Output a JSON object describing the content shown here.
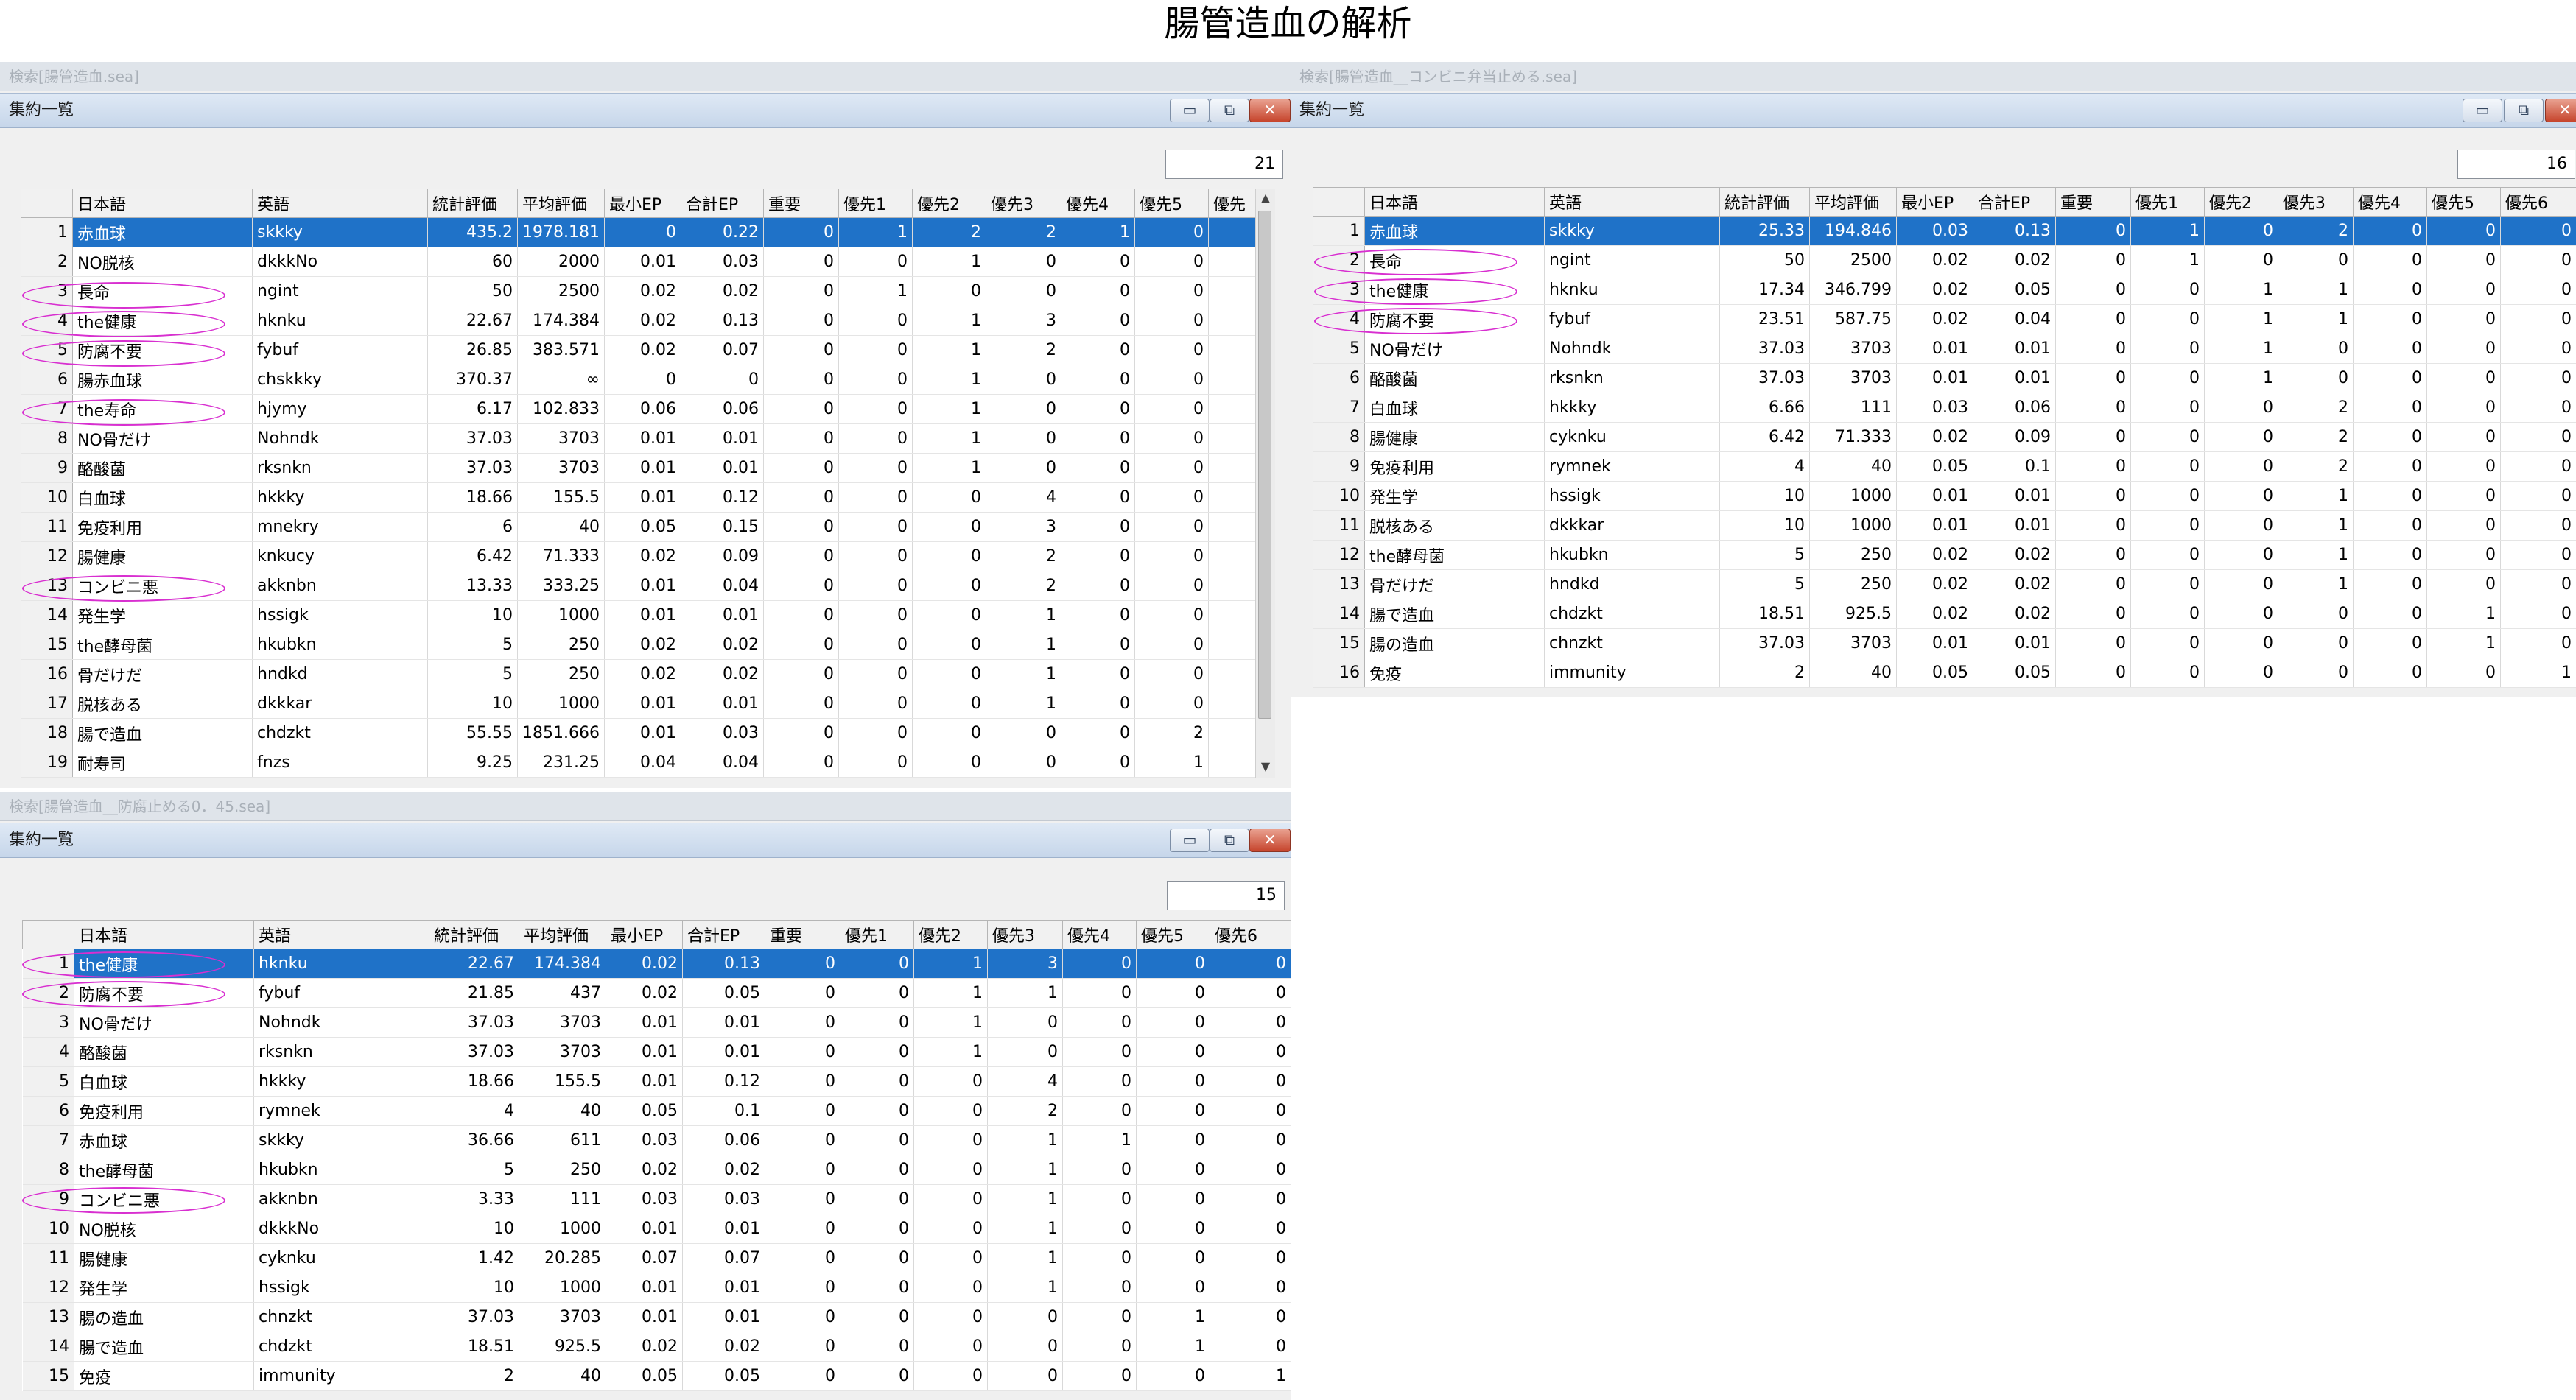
{
  "page_title": "腸管造血の解析",
  "windows": [
    {
      "id": "w1",
      "search_title": "検索[腸管造血.sea]",
      "window_title": "集約一覧",
      "count": "21",
      "columns": [
        "日本語",
        "英語",
        "統計評価",
        "平均評価",
        "最小EP",
        "合計EP",
        "重要",
        "優先1",
        "優先2",
        "優先3",
        "優先4",
        "優先5",
        "優先"
      ],
      "rows": [
        [
          "1",
          "赤血球",
          "skkky",
          "435.2",
          "1978.181",
          "0",
          "0.22",
          "0",
          "1",
          "2",
          "2",
          "1",
          "0",
          ""
        ],
        [
          "2",
          "NO脱核",
          "dkkkNo",
          "60",
          "2000",
          "0.01",
          "0.03",
          "0",
          "0",
          "1",
          "0",
          "0",
          "0",
          ""
        ],
        [
          "3",
          "長命",
          "ngint",
          "50",
          "2500",
          "0.02",
          "0.02",
          "0",
          "1",
          "0",
          "0",
          "0",
          "0",
          ""
        ],
        [
          "4",
          "the健康",
          "hknku",
          "22.67",
          "174.384",
          "0.02",
          "0.13",
          "0",
          "0",
          "1",
          "3",
          "0",
          "0",
          ""
        ],
        [
          "5",
          "防腐不要",
          "fybuf",
          "26.85",
          "383.571",
          "0.02",
          "0.07",
          "0",
          "0",
          "1",
          "2",
          "0",
          "0",
          ""
        ],
        [
          "6",
          "腸赤血球",
          "chskkky",
          "370.37",
          "∞",
          "0",
          "0",
          "0",
          "0",
          "1",
          "0",
          "0",
          "0",
          ""
        ],
        [
          "7",
          "the寿命",
          "hjymy",
          "6.17",
          "102.833",
          "0.06",
          "0.06",
          "0",
          "0",
          "1",
          "0",
          "0",
          "0",
          ""
        ],
        [
          "8",
          "NO骨だけ",
          "Nohndk",
          "37.03",
          "3703",
          "0.01",
          "0.01",
          "0",
          "0",
          "1",
          "0",
          "0",
          "0",
          ""
        ],
        [
          "9",
          "酪酸菌",
          "rksnkn",
          "37.03",
          "3703",
          "0.01",
          "0.01",
          "0",
          "0",
          "1",
          "0",
          "0",
          "0",
          ""
        ],
        [
          "10",
          "白血球",
          "hkkky",
          "18.66",
          "155.5",
          "0.01",
          "0.12",
          "0",
          "0",
          "0",
          "4",
          "0",
          "0",
          ""
        ],
        [
          "11",
          "免疫利用",
          "mnekry",
          "6",
          "40",
          "0.05",
          "0.15",
          "0",
          "0",
          "0",
          "3",
          "0",
          "0",
          ""
        ],
        [
          "12",
          "腸健康",
          "knkucy",
          "6.42",
          "71.333",
          "0.02",
          "0.09",
          "0",
          "0",
          "0",
          "2",
          "0",
          "0",
          ""
        ],
        [
          "13",
          "コンビニ悪",
          "akknbn",
          "13.33",
          "333.25",
          "0.01",
          "0.04",
          "0",
          "0",
          "0",
          "2",
          "0",
          "0",
          ""
        ],
        [
          "14",
          "発生学",
          "hssigk",
          "10",
          "1000",
          "0.01",
          "0.01",
          "0",
          "0",
          "0",
          "1",
          "0",
          "0",
          ""
        ],
        [
          "15",
          "the酵母菌",
          "hkubkn",
          "5",
          "250",
          "0.02",
          "0.02",
          "0",
          "0",
          "0",
          "1",
          "0",
          "0",
          ""
        ],
        [
          "16",
          "骨だけだ",
          "hndkd",
          "5",
          "250",
          "0.02",
          "0.02",
          "0",
          "0",
          "0",
          "1",
          "0",
          "0",
          ""
        ],
        [
          "17",
          "脱核ある",
          "dkkkar",
          "10",
          "1000",
          "0.01",
          "0.01",
          "0",
          "0",
          "0",
          "1",
          "0",
          "0",
          ""
        ],
        [
          "18",
          "腸で造血",
          "chdzkt",
          "55.55",
          "1851.666",
          "0.01",
          "0.03",
          "0",
          "0",
          "0",
          "0",
          "0",
          "2",
          ""
        ],
        [
          "19",
          "耐寿司",
          "fnzs",
          "9.25",
          "231.25",
          "0.04",
          "0.04",
          "0",
          "0",
          "0",
          "0",
          "0",
          "1",
          ""
        ]
      ]
    },
    {
      "id": "w2",
      "search_title": "検索[腸管造血__コンビニ弁当止める.sea]",
      "window_title": "集約一覧",
      "count": "16",
      "columns": [
        "日本語",
        "英語",
        "統計評価",
        "平均評価",
        "最小EP",
        "合計EP",
        "重要",
        "優先1",
        "優先2",
        "優先3",
        "優先4",
        "優先5",
        "優先6"
      ],
      "rows": [
        [
          "1",
          "赤血球",
          "skkky",
          "25.33",
          "194.846",
          "0.03",
          "0.13",
          "0",
          "1",
          "0",
          "2",
          "0",
          "0",
          "0"
        ],
        [
          "2",
          "長命",
          "ngint",
          "50",
          "2500",
          "0.02",
          "0.02",
          "0",
          "1",
          "0",
          "0",
          "0",
          "0",
          "0"
        ],
        [
          "3",
          "the健康",
          "hknku",
          "17.34",
          "346.799",
          "0.02",
          "0.05",
          "0",
          "0",
          "1",
          "1",
          "0",
          "0",
          "0"
        ],
        [
          "4",
          "防腐不要",
          "fybuf",
          "23.51",
          "587.75",
          "0.02",
          "0.04",
          "0",
          "0",
          "1",
          "1",
          "0",
          "0",
          "0"
        ],
        [
          "5",
          "NO骨だけ",
          "Nohndk",
          "37.03",
          "3703",
          "0.01",
          "0.01",
          "0",
          "0",
          "1",
          "0",
          "0",
          "0",
          "0"
        ],
        [
          "6",
          "酪酸菌",
          "rksnkn",
          "37.03",
          "3703",
          "0.01",
          "0.01",
          "0",
          "0",
          "1",
          "0",
          "0",
          "0",
          "0"
        ],
        [
          "7",
          "白血球",
          "hkkky",
          "6.66",
          "111",
          "0.03",
          "0.06",
          "0",
          "0",
          "0",
          "2",
          "0",
          "0",
          "0"
        ],
        [
          "8",
          "腸健康",
          "cyknku",
          "6.42",
          "71.333",
          "0.02",
          "0.09",
          "0",
          "0",
          "0",
          "2",
          "0",
          "0",
          "0"
        ],
        [
          "9",
          "免疫利用",
          "rymnek",
          "4",
          "40",
          "0.05",
          "0.1",
          "0",
          "0",
          "0",
          "2",
          "0",
          "0",
          "0"
        ],
        [
          "10",
          "発生学",
          "hssigk",
          "10",
          "1000",
          "0.01",
          "0.01",
          "0",
          "0",
          "0",
          "1",
          "0",
          "0",
          "0"
        ],
        [
          "11",
          "脱核ある",
          "dkkkar",
          "10",
          "1000",
          "0.01",
          "0.01",
          "0",
          "0",
          "0",
          "1",
          "0",
          "0",
          "0"
        ],
        [
          "12",
          "the酵母菌",
          "hkubkn",
          "5",
          "250",
          "0.02",
          "0.02",
          "0",
          "0",
          "0",
          "1",
          "0",
          "0",
          "0"
        ],
        [
          "13",
          "骨だけだ",
          "hndkd",
          "5",
          "250",
          "0.02",
          "0.02",
          "0",
          "0",
          "0",
          "1",
          "0",
          "0",
          "0"
        ],
        [
          "14",
          "腸で造血",
          "chdzkt",
          "18.51",
          "925.5",
          "0.02",
          "0.02",
          "0",
          "0",
          "0",
          "0",
          "0",
          "1",
          "0"
        ],
        [
          "15",
          "腸の造血",
          "chnzkt",
          "37.03",
          "3703",
          "0.01",
          "0.01",
          "0",
          "0",
          "0",
          "0",
          "0",
          "1",
          "0"
        ],
        [
          "16",
          "免疫",
          "immunity",
          "2",
          "40",
          "0.05",
          "0.05",
          "0",
          "0",
          "0",
          "0",
          "0",
          "0",
          "1"
        ]
      ]
    },
    {
      "id": "w3",
      "search_title": "検索[腸管造血__防腐止める0．45.sea]",
      "window_title": "集約一覧",
      "count": "15",
      "columns": [
        "日本語",
        "英語",
        "統計評価",
        "平均評価",
        "最小EP",
        "合計EP",
        "重要",
        "優先1",
        "優先2",
        "優先3",
        "優先4",
        "優先5",
        "優先6"
      ],
      "rows": [
        [
          "1",
          "the健康",
          "hknku",
          "22.67",
          "174.384",
          "0.02",
          "0.13",
          "0",
          "0",
          "1",
          "3",
          "0",
          "0",
          "0"
        ],
        [
          "2",
          "防腐不要",
          "fybuf",
          "21.85",
          "437",
          "0.02",
          "0.05",
          "0",
          "0",
          "1",
          "1",
          "0",
          "0",
          "0"
        ],
        [
          "3",
          "NO骨だけ",
          "Nohndk",
          "37.03",
          "3703",
          "0.01",
          "0.01",
          "0",
          "0",
          "1",
          "0",
          "0",
          "0",
          "0"
        ],
        [
          "4",
          "酪酸菌",
          "rksnkn",
          "37.03",
          "3703",
          "0.01",
          "0.01",
          "0",
          "0",
          "1",
          "0",
          "0",
          "0",
          "0"
        ],
        [
          "5",
          "白血球",
          "hkkky",
          "18.66",
          "155.5",
          "0.01",
          "0.12",
          "0",
          "0",
          "0",
          "4",
          "0",
          "0",
          "0"
        ],
        [
          "6",
          "免疫利用",
          "rymnek",
          "4",
          "40",
          "0.05",
          "0.1",
          "0",
          "0",
          "0",
          "2",
          "0",
          "0",
          "0"
        ],
        [
          "7",
          "赤血球",
          "skkky",
          "36.66",
          "611",
          "0.03",
          "0.06",
          "0",
          "0",
          "0",
          "1",
          "1",
          "0",
          "0"
        ],
        [
          "8",
          "the酵母菌",
          "hkubkn",
          "5",
          "250",
          "0.02",
          "0.02",
          "0",
          "0",
          "0",
          "1",
          "0",
          "0",
          "0"
        ],
        [
          "9",
          "コンビニ悪",
          "akknbn",
          "3.33",
          "111",
          "0.03",
          "0.03",
          "0",
          "0",
          "0",
          "1",
          "0",
          "0",
          "0"
        ],
        [
          "10",
          "NO脱核",
          "dkkkNo",
          "10",
          "1000",
          "0.01",
          "0.01",
          "0",
          "0",
          "0",
          "1",
          "0",
          "0",
          "0"
        ],
        [
          "11",
          "腸健康",
          "cyknku",
          "1.42",
          "20.285",
          "0.07",
          "0.07",
          "0",
          "0",
          "0",
          "1",
          "0",
          "0",
          "0"
        ],
        [
          "12",
          "発生学",
          "hssigk",
          "10",
          "1000",
          "0.01",
          "0.01",
          "0",
          "0",
          "0",
          "1",
          "0",
          "0",
          "0"
        ],
        [
          "13",
          "腸の造血",
          "chnzkt",
          "37.03",
          "3703",
          "0.01",
          "0.01",
          "0",
          "0",
          "0",
          "0",
          "0",
          "1",
          "0"
        ],
        [
          "14",
          "腸で造血",
          "chdzkt",
          "18.51",
          "925.5",
          "0.02",
          "0.02",
          "0",
          "0",
          "0",
          "0",
          "0",
          "1",
          "0"
        ],
        [
          "15",
          "免疫",
          "immunity",
          "2",
          "40",
          "0.05",
          "0.05",
          "0",
          "0",
          "0",
          "0",
          "0",
          "0",
          "1"
        ]
      ]
    }
  ],
  "window_buttons": {
    "minimize": "▭",
    "restore": "⧉",
    "close": "✕"
  },
  "scroll_arrows": {
    "up": "▲",
    "down": "▼"
  },
  "icons": [
    "minimize-icon",
    "restore-icon",
    "close-icon",
    "scroll-up-icon",
    "scroll-down-icon"
  ],
  "colors": {
    "selection": "#1f72c8",
    "highlight_ring": "#d82fd0",
    "titlebar": "#c6d6ea"
  }
}
